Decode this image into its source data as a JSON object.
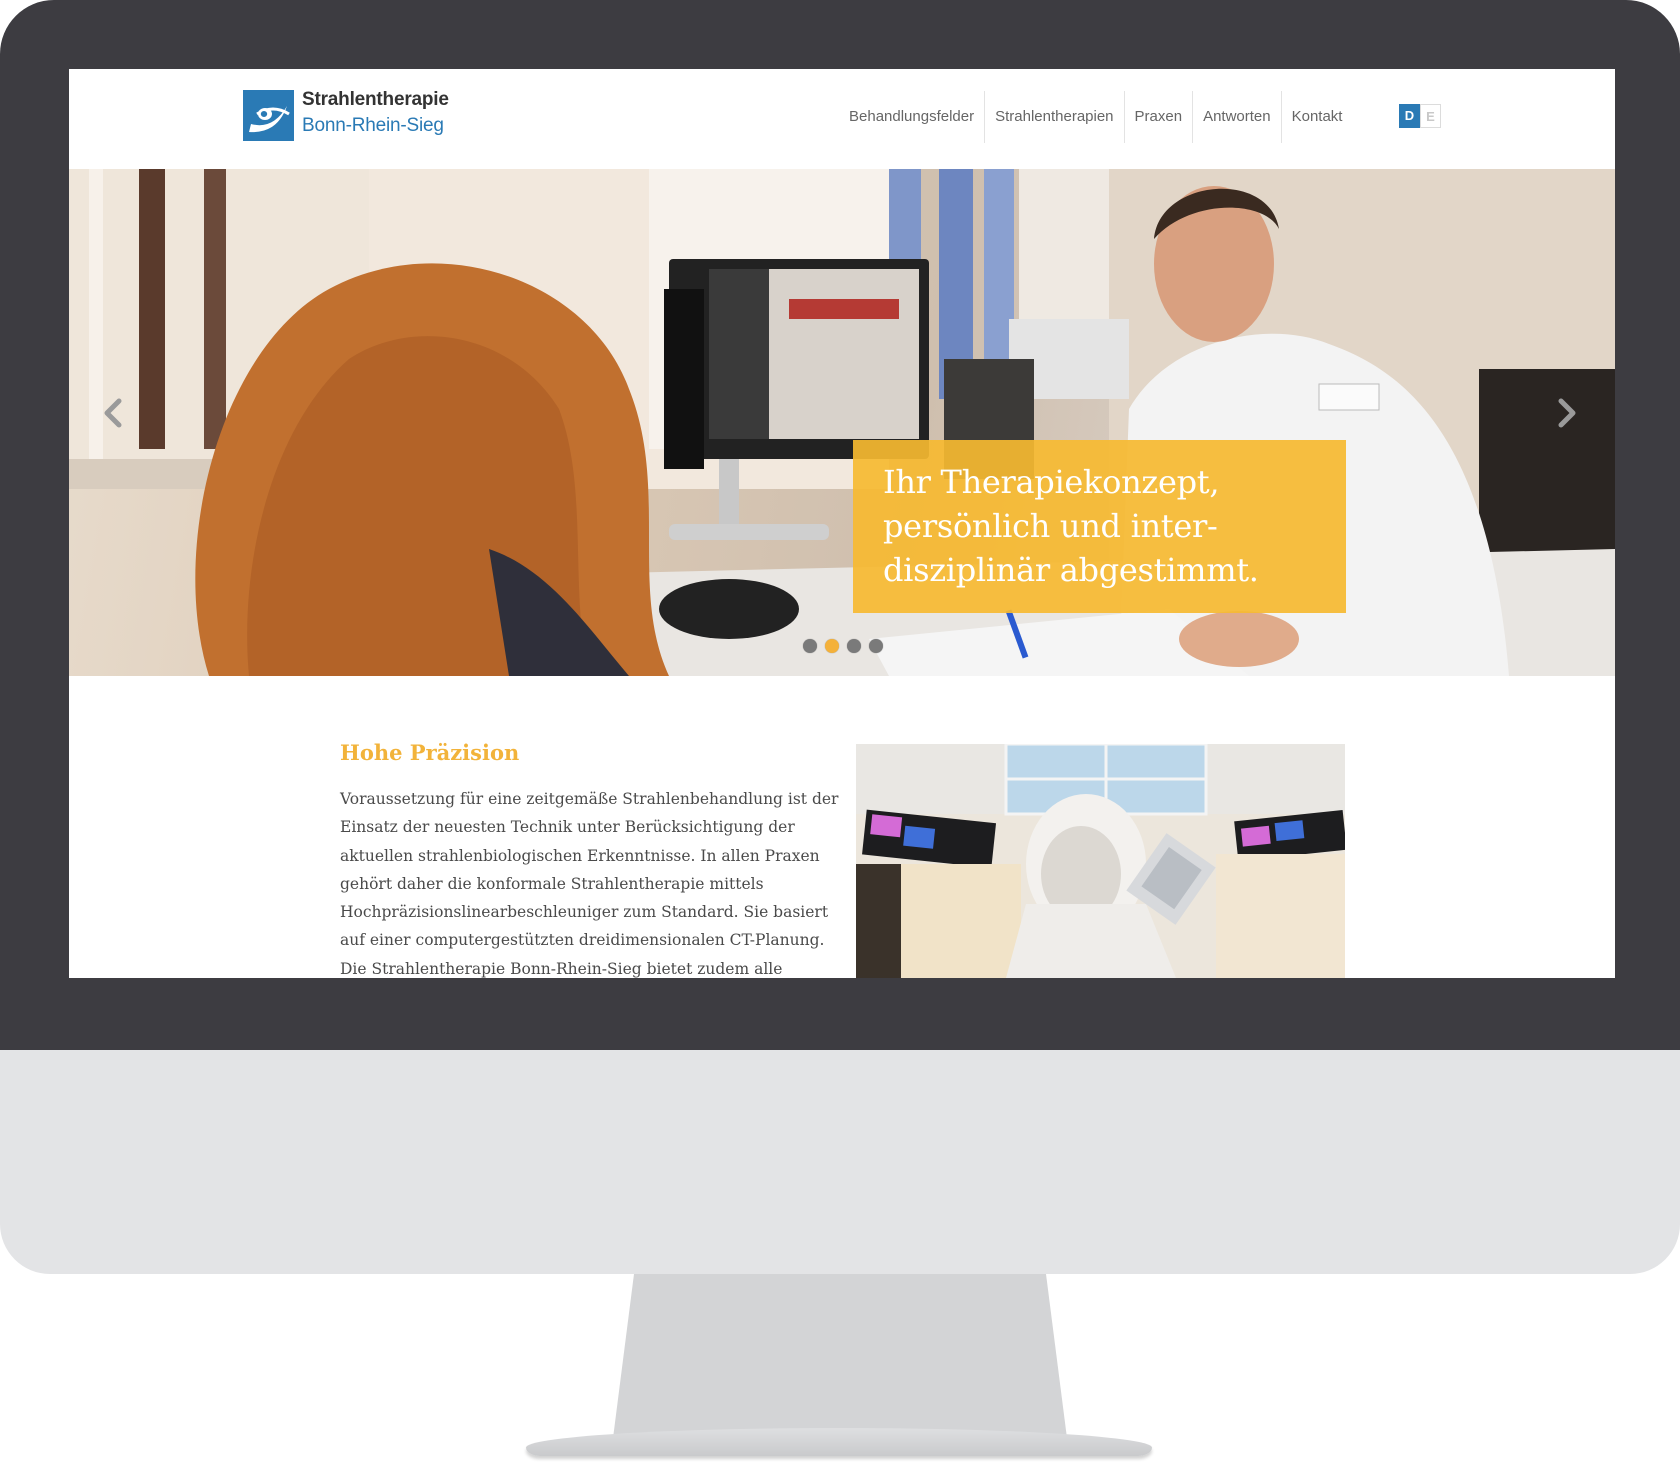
{
  "header": {
    "logo_title": "Strahlentherapie",
    "logo_subtitle": "Bonn-Rhein-Sieg",
    "nav_items": [
      "Behandlungsfelder",
      "Strahlentherapien",
      "Praxen",
      "Antworten",
      "Kontakt"
    ],
    "languages": {
      "active": "D",
      "inactive": "E"
    }
  },
  "hero": {
    "caption_lines": [
      "Ihr Therapiekonzept,",
      "persönlich und inter-",
      "disziplinär abgestimmt."
    ],
    "slide_count": 4,
    "active_slide": 2
  },
  "content": {
    "heading": "Hohe Präzision",
    "body_lines": [
      "Voraussetzung für eine zeitgemäße Strahlenbehandlung ist der",
      "Einsatz der neuesten Technik unter Berücksichtigung der",
      "aktuellen strahlenbiologischen Erkenntnisse. In allen Praxen",
      "gehört daher die konformale Strahlentherapie mittels",
      "Hochpräzisionslinearbeschleuniger zum Standard. Sie basiert",
      "auf einer computergestützten dreidimensionalen CT-Planung.",
      "Die Strahlentherapie Bonn-Rhein-Sieg bietet zudem alle"
    ]
  },
  "icons": {
    "logo": "eye-swoosh-logo-icon",
    "prev": "chevron-left-icon",
    "next": "chevron-right-icon"
  },
  "colors": {
    "brand_blue": "#2a7ab5",
    "accent_yellow": "#f6ba31",
    "bezel": "#3d3c41",
    "chin": "#e3e4e6"
  }
}
